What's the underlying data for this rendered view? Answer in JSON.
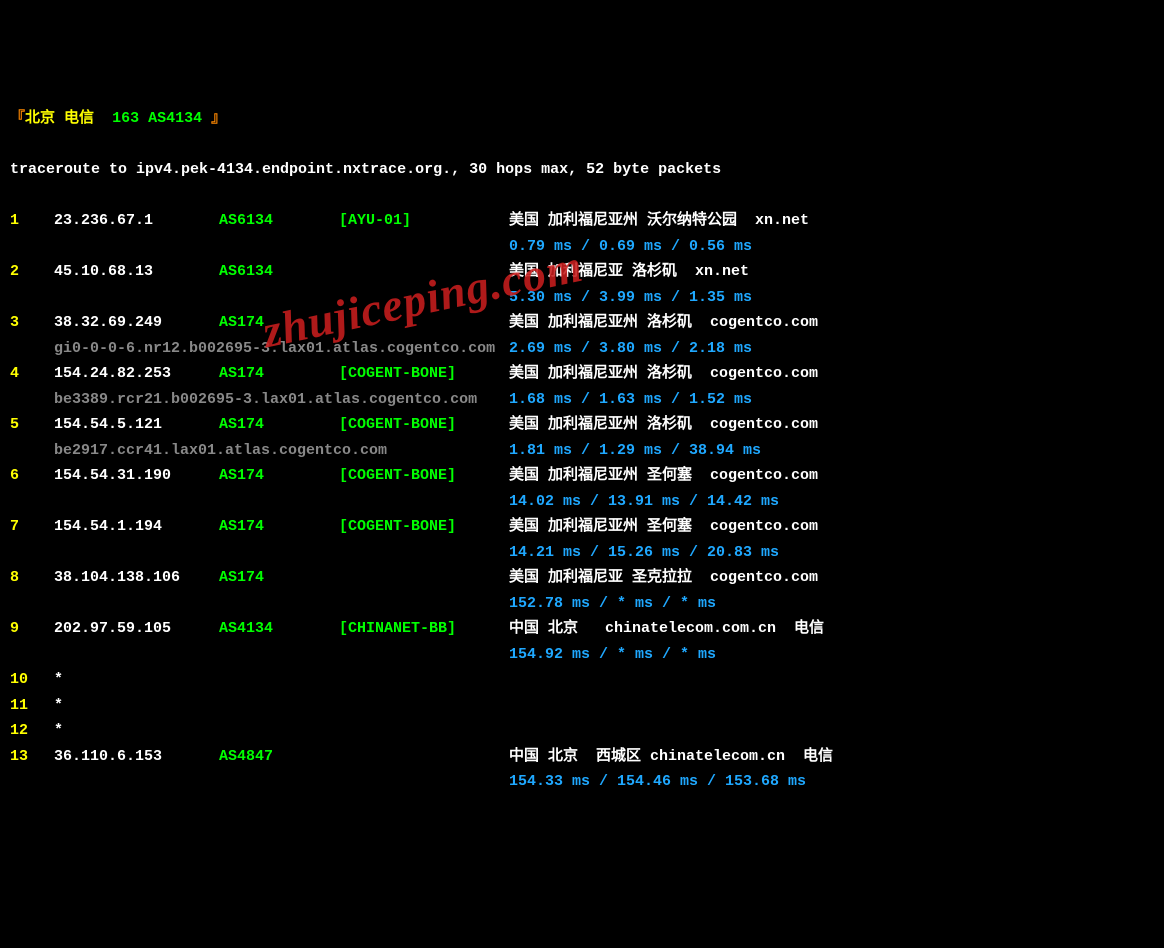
{
  "header": {
    "bracket_open": "『",
    "location": "北京",
    "carrier": "电信",
    "route": "163",
    "asn": "AS4134",
    "bracket_close": "』"
  },
  "trace_line": "traceroute to ipv4.pek-4134.endpoint.nxtrace.org., 30 hops max, 52 byte packets",
  "hops": [
    {
      "n": "1",
      "ip": "23.236.67.1",
      "as": "AS6134",
      "tag": "[AYU-01]",
      "loc": "美国 加利福尼亚州 沃尔纳特公园  xn.net",
      "times": "0.79 ms / 0.69 ms / 0.56 ms",
      "dns": ""
    },
    {
      "n": "2",
      "ip": "45.10.68.13",
      "as": "AS6134",
      "tag": "",
      "loc": "美国 加利福尼亚 洛杉矶  xn.net",
      "times": "5.30 ms / 3.99 ms / 1.35 ms",
      "dns": ""
    },
    {
      "n": "3",
      "ip": "38.32.69.249",
      "as": "AS174",
      "tag": "",
      "loc": "美国 加利福尼亚州 洛杉矶  cogentco.com",
      "times": "",
      "dns": "gi0-0-0-6.nr12.b002695-3.lax01.atlas.cogentco.com",
      "dns_times": "2.69 ms / 3.80 ms / 2.18 ms"
    },
    {
      "n": "4",
      "ip": "154.24.82.253",
      "as": "AS174",
      "tag": "[COGENT-BONE]",
      "loc": "美国 加利福尼亚州 洛杉矶  cogentco.com",
      "times": "",
      "dns": "be3389.rcr21.b002695-3.lax01.atlas.cogentco.com",
      "dns_times": "1.68 ms / 1.63 ms / 1.52 ms"
    },
    {
      "n": "5",
      "ip": "154.54.5.121",
      "as": "AS174",
      "tag": "[COGENT-BONE]",
      "loc": "美国 加利福尼亚州 洛杉矶  cogentco.com",
      "times": "",
      "dns": "be2917.ccr41.lax01.atlas.cogentco.com",
      "dns_times": "1.81 ms / 1.29 ms / 38.94 ms"
    },
    {
      "n": "6",
      "ip": "154.54.31.190",
      "as": "AS174",
      "tag": "[COGENT-BONE]",
      "loc": "美国 加利福尼亚州 圣何塞  cogentco.com",
      "times": "14.02 ms / 13.91 ms / 14.42 ms",
      "dns": ""
    },
    {
      "n": "7",
      "ip": "154.54.1.194",
      "as": "AS174",
      "tag": "[COGENT-BONE]",
      "loc": "美国 加利福尼亚州 圣何塞  cogentco.com",
      "times": "14.21 ms / 15.26 ms / 20.83 ms",
      "dns": ""
    },
    {
      "n": "8",
      "ip": "38.104.138.106",
      "as": "AS174",
      "tag": "",
      "loc": "美国 加利福尼亚 圣克拉拉  cogentco.com",
      "times": "152.78 ms / * ms / * ms",
      "dns": ""
    },
    {
      "n": "9",
      "ip": "202.97.59.105",
      "as": "AS4134",
      "tag": "[CHINANET-BB]",
      "loc": "中国 北京   chinatelecom.com.cn  电信",
      "times": "154.92 ms / * ms / * ms",
      "dns": ""
    },
    {
      "n": "10",
      "ip": "*",
      "as": "",
      "tag": "",
      "loc": "",
      "times": "",
      "dns": ""
    },
    {
      "n": "11",
      "ip": "*",
      "as": "",
      "tag": "",
      "loc": "",
      "times": "",
      "dns": ""
    },
    {
      "n": "12",
      "ip": "*",
      "as": "",
      "tag": "",
      "loc": "",
      "times": "",
      "dns": ""
    },
    {
      "n": "13",
      "ip": "36.110.6.153",
      "as": "AS4847",
      "tag": "",
      "loc": "中国 北京  西城区 chinatelecom.cn  电信",
      "times": "154.33 ms / 154.46 ms / 153.68 ms",
      "dns": ""
    }
  ],
  "watermark": "zhujiceping.com"
}
